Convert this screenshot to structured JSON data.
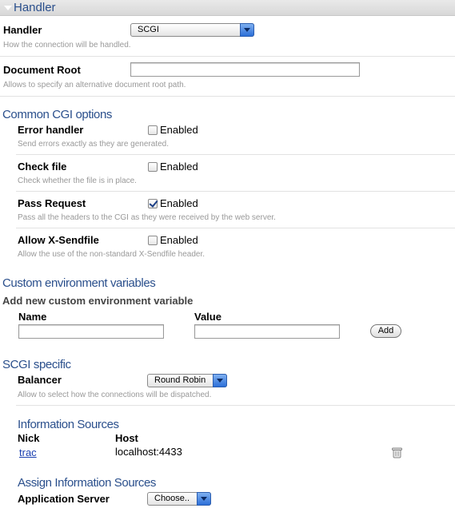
{
  "handler_section": {
    "title": "Handler"
  },
  "handler": {
    "label": "Handler",
    "selected": "SCGI",
    "help": "How the connection will be handled."
  },
  "document_root": {
    "label": "Document Root",
    "value": "",
    "help": "Allows to specify an alternative document root path."
  },
  "cgi_options": {
    "title": "Common CGI options",
    "items": [
      {
        "label": "Error handler",
        "checkbox_label": "Enabled",
        "checked": false,
        "help": "Send errors exactly as they are generated."
      },
      {
        "label": "Check file",
        "checkbox_label": "Enabled",
        "checked": false,
        "help": "Check whether the file is in place."
      },
      {
        "label": "Pass Request",
        "checkbox_label": "Enabled",
        "checked": true,
        "help": "Pass all the headers to the CGI as they were received by the web server."
      },
      {
        "label": "Allow X-Sendfile",
        "checkbox_label": "Enabled",
        "checked": false,
        "help": "Allow the use of the non-standard X-Sendfile header."
      }
    ]
  },
  "custom_env": {
    "title": "Custom environment variables",
    "add_heading": "Add new custom environment variable",
    "name_label": "Name",
    "value_label": "Value",
    "name_value": "",
    "value_value": "",
    "add_button": "Add"
  },
  "scgi": {
    "title": "SCGI specific",
    "balancer_label": "Balancer",
    "balancer_selected": "Round Robin",
    "balancer_help": "Allow to select how the connections will be dispatched."
  },
  "info_sources": {
    "title": "Information Sources",
    "col_nick": "Nick",
    "col_host": "Host",
    "rows": [
      {
        "nick": "trac",
        "host": "localhost:4433"
      }
    ]
  },
  "assign_sources": {
    "title": "Assign Information Sources",
    "app_server_label": "Application Server",
    "app_server_selected": "Choose.."
  }
}
